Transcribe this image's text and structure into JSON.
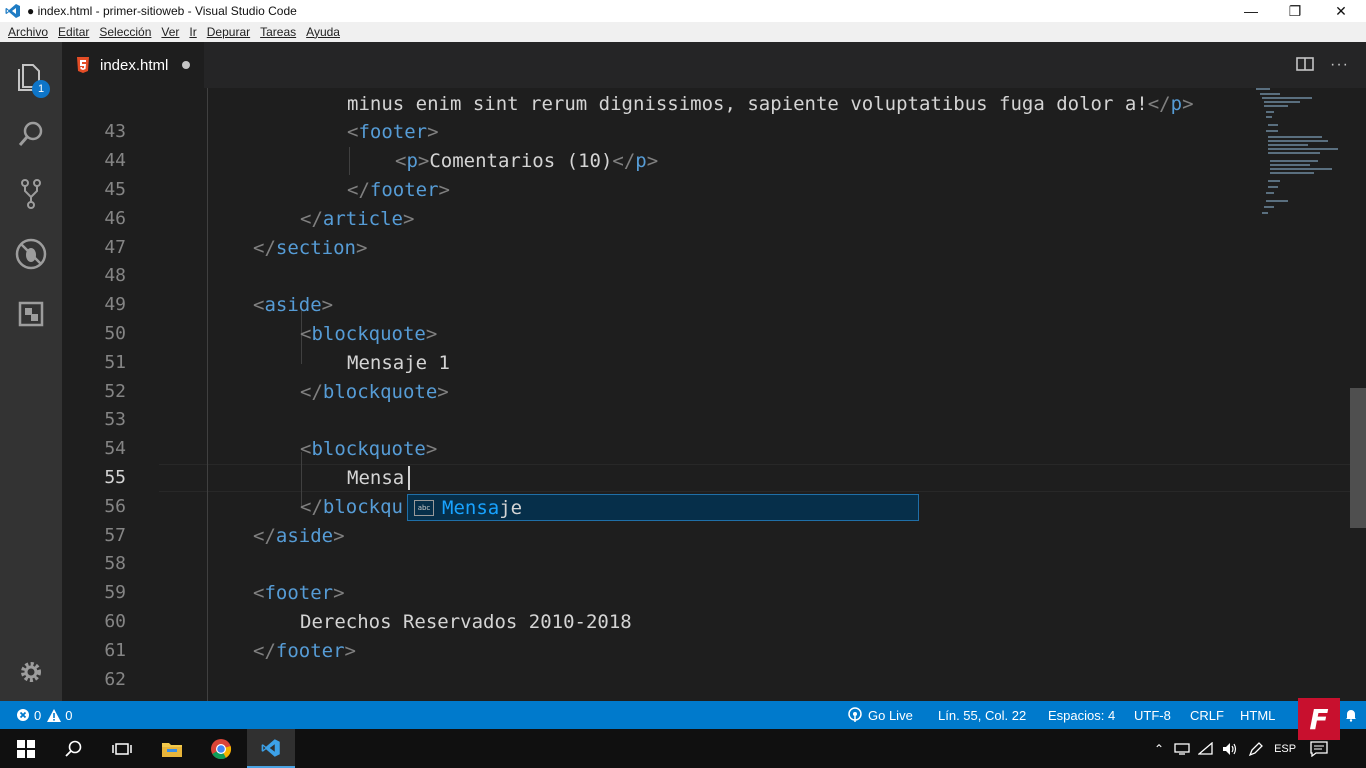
{
  "window": {
    "title": "● index.html - primer-sitioweb - Visual Studio Code",
    "minimize": "—",
    "restore": "❐",
    "close": "✕"
  },
  "menu": [
    "Archivo",
    "Editar",
    "Selección",
    "Ver",
    "Ir",
    "Depurar",
    "Tareas",
    "Ayuda"
  ],
  "activity": {
    "explorer_badge": "1"
  },
  "tab": {
    "name": "index.html"
  },
  "editor": {
    "partial_line": "minus enim sint rerum dignissimos, sapiente voluptatibus fuga dolor a!",
    "line_numbers": [
      "43",
      "44",
      "45",
      "46",
      "47",
      "48",
      "49",
      "50",
      "51",
      "52",
      "53",
      "54",
      "55",
      "56",
      "57",
      "58",
      "59",
      "60",
      "61",
      "62"
    ],
    "active_line": "55",
    "lines": {
      "l43": "footer",
      "l44_tag": "p",
      "l44_text": "Comentarios (10)",
      "l45": "footer",
      "l46": "article",
      "l47": "section",
      "l49": "aside",
      "l50": "blockquote",
      "l51": "Mensaje 1",
      "l52": "blockquote",
      "l54": "blockquote",
      "l55": "Mensa",
      "l56": "blockqu",
      "l57": "aside",
      "l59": "footer",
      "l60": "Derechos Reservados 2010-2018",
      "l61": "footer"
    }
  },
  "suggestion": {
    "match": "Mensa",
    "rest": "je",
    "icon_text": "abc"
  },
  "status": {
    "errors": "0",
    "warnings": "0",
    "go_live": "Go Live",
    "position": "Lín. 55, Col. 22",
    "spaces": "Espacios: 4",
    "encoding": "UTF-8",
    "eol": "CRLF",
    "language": "HTML"
  },
  "taskbar": {
    "lang": "ESP"
  },
  "overlay": {
    "logo": "F"
  },
  "colors": {
    "status_bar": "#007acc",
    "tag": "#569cd6",
    "suggest_highlight": "#18a3ff"
  }
}
